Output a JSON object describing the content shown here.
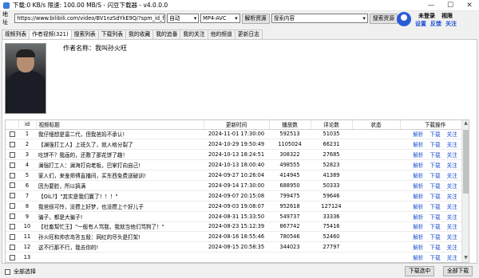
{
  "window": {
    "title": "下载:0 KB/s 限速: 100.00 MB/S - 闪豆下载器 - v4.0.0.0",
    "controls": [
      "—",
      "☐",
      "✕"
    ]
  },
  "toolbar": {
    "url_label": "地址",
    "url_value": "https://www.bilibili.com/video/BV1nzSdYkE9Q/?spm_id_f",
    "quality_value": "自动",
    "format_value": "MP4-AVC",
    "parse_button": "解析资源",
    "search_value": "搜索内容",
    "search_button": "搜索资源"
  },
  "user": {
    "status": "未登录",
    "vip": "视限",
    "settings": "设置",
    "feedback": "反馈",
    "follow": "关注"
  },
  "tabs": [
    "视频列表",
    "作者视频(321)",
    "搜索列表",
    "下载列表",
    "我的收藏",
    "我的追番",
    "我的关注",
    "他的频道",
    "更新日志"
  ],
  "author": {
    "name_label": "作者名称：我叫孙火旺"
  },
  "table": {
    "columns": [
      "",
      "id",
      "视频标题",
      "更新时间",
      "播放数",
      "评论数",
      "状态",
      "下载操作"
    ],
    "actions": [
      "解析",
      "下载",
      "关注"
    ],
    "rows": [
      {
        "id": "1",
        "title": "我仔细想是富二代，但我爸妈不承认!",
        "time": "2024-11-01 17:30:00",
        "plays": "592513",
        "comments": "51035"
      },
      {
        "id": "2",
        "title": "【澜强打工人】上班久了，就人格分裂了",
        "time": "2024-10-29 19:50:49",
        "plays": "1105024",
        "comments": "66231"
      },
      {
        "id": "3",
        "title": "吃饼不？我画的，还敷了那花饼了趣！",
        "time": "2024-10-13 18:24:51",
        "plays": "308322",
        "comments": "27685"
      },
      {
        "id": "4",
        "title": "澜强打工人：澜海打向老板，巴掌打向自己!",
        "time": "2024-10-13 18:00:40",
        "plays": "498555",
        "comments": "52823"
      },
      {
        "id": "5",
        "title": "家人们，来鉴师傅直播间，买东西免费送破训!",
        "time": "2024-09-27 10:26:04",
        "plays": "414945",
        "comments": "41389"
      },
      {
        "id": "6",
        "title": "因为要脸，所以搞满",
        "time": "2024-09-14 17:30:00",
        "plays": "688950",
        "comments": "50333"
      },
      {
        "id": "7",
        "title": "【OiL?】\"其实是我们赢了！！！\"",
        "time": "2024-09-07 20:15:08",
        "plays": "799475",
        "comments": "59646"
      },
      {
        "id": "8",
        "title": "我爸很可怜，没攒上好梦，也没攒上个好儿子",
        "time": "2024-09-03 19:08:07",
        "plays": "952618",
        "comments": "127124"
      },
      {
        "id": "9",
        "title": "骗子，都是大骗子!",
        "time": "2024-08-31 15:33:50",
        "plays": "549737",
        "comments": "33336"
      },
      {
        "id": "10",
        "title": "【社畜幫忙王】\"一般有人骂我，我就当他们骂狗了！\"",
        "time": "2024-08-23 15:12:39",
        "plays": "867742",
        "comments": "75416"
      },
      {
        "id": "11",
        "title": "孙火旺和帅农岛答五殺：网红的尽头是打架!",
        "time": "2024-08-16 18:55:46",
        "plays": "780546",
        "comments": "52460"
      },
      {
        "id": "12",
        "title": "这不行那不行，我去你的!",
        "time": "2024-08-15 20:58:35",
        "plays": "344023",
        "comments": "27797"
      },
      {
        "id": "13",
        "title": "",
        "time": "",
        "plays": "",
        "comments": ""
      }
    ]
  },
  "footer": {
    "select_all": "全部选择",
    "download_selected": "下载选中",
    "download_all": "全部下载"
  }
}
